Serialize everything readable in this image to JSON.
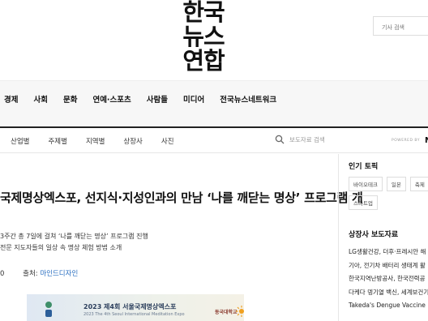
{
  "site": {
    "logo_lines": [
      "한국",
      "뉴스",
      "연합"
    ]
  },
  "search": {
    "placeholder": "기사 검색"
  },
  "main_nav": [
    "경제",
    "사회",
    "문화",
    "연예·스포츠",
    "사람들",
    "미디어",
    "전국뉴스네트워크"
  ],
  "sub_nav": [
    "산업별",
    "주제별",
    "지역별",
    "상장사",
    "사진"
  ],
  "sub_search": {
    "placeholder": "보도자료 검색",
    "powered_by": "POWERED BY",
    "brand_letter": "N"
  },
  "article": {
    "title": "국제명상엑스포, 선지식·지성인과의 만남 ‘나를 깨닫는 명상’ 프로그램 개",
    "summary": [
      "3주간 총 7일에 걸쳐 ‘나를 깨닫는 명상’ 프로그램 진행",
      "전문 지도자들의 일상 속 명상 체험 방법 소개"
    ],
    "meta_prefix": "0",
    "source_label": "출처:",
    "source": "마인드디자인",
    "poster_title": "2023 제4회 서울국제명상엑스포",
    "poster_subtitle": "2023 The 4th Seoul International Meditation Expo",
    "poster_logo": "동국대학교"
  },
  "sidebar": {
    "topics_title": "인기 토픽",
    "tags": [
      "바이오테크",
      "일본",
      "축제",
      "스타트업"
    ],
    "releases_title": "상장사 보도자료",
    "releases": [
      "LG생활건강, 더후·프레시안 해",
      "기아, 전기차 배터리 생태계 활",
      "한국지역난방공사, 한국전력공",
      "다케다 뎅기열 백신, 세계보건기",
      "Takeda's Dengue Vaccine"
    ]
  },
  "colors": {
    "accent_link": "#2a6fc1",
    "nav_band": "#f7f7f7"
  }
}
